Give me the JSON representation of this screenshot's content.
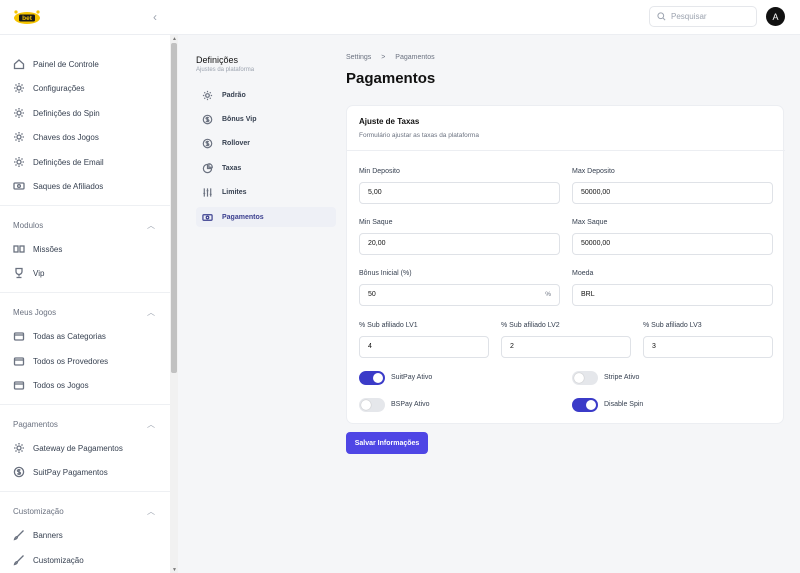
{
  "header": {
    "logo_text": "bet",
    "search_placeholder": "Pesquisar",
    "avatar_letter": "A"
  },
  "sidebar": {
    "top_items": [
      {
        "label": "Painel de Controle",
        "icon": "home-icon"
      },
      {
        "label": "Configurações",
        "icon": "gear-icon"
      },
      {
        "label": "Definições do Spin",
        "icon": "gear-icon"
      },
      {
        "label": "Chaves dos Jogos",
        "icon": "gear-icon"
      },
      {
        "label": "Definições de Email",
        "icon": "gear-icon"
      },
      {
        "label": "Saques de Afiliados",
        "icon": "money-icon"
      }
    ],
    "sections": [
      {
        "title": "Modulos",
        "items": [
          {
            "label": "Missões",
            "icon": "grid-icon"
          },
          {
            "label": "Vip",
            "icon": "trophy-icon"
          }
        ]
      },
      {
        "title": "Meus Jogos",
        "items": [
          {
            "label": "Todas as Categorias",
            "icon": "folder-icon"
          },
          {
            "label": "Todos os Provedores",
            "icon": "folder-icon"
          },
          {
            "label": "Todos os Jogos",
            "icon": "folder-icon"
          }
        ]
      },
      {
        "title": "Pagamentos",
        "items": [
          {
            "label": "Gateway de Pagamentos",
            "icon": "gear-icon"
          },
          {
            "label": "SuitPay Pagamentos",
            "icon": "dollar-icon"
          }
        ]
      },
      {
        "title": "Customização",
        "items": [
          {
            "label": "Banners",
            "icon": "brush-icon"
          },
          {
            "label": "Customização",
            "icon": "brush-icon"
          }
        ]
      }
    ]
  },
  "submenu": {
    "title": "Definições",
    "caption": "Ajustes da plataforma",
    "items": [
      {
        "label": "Padrão",
        "icon": "gear-icon"
      },
      {
        "label": "Bônus Vip",
        "icon": "dollar-icon"
      },
      {
        "label": "Rollover",
        "icon": "dollar-icon"
      },
      {
        "label": "Taxas",
        "icon": "pie-chart-icon"
      },
      {
        "label": "Limites",
        "icon": "sliders-icon"
      },
      {
        "label": "Pagamentos",
        "icon": "money-icon"
      }
    ],
    "active": "Pagamentos"
  },
  "breadcrumb": {
    "root": "Settings",
    "separator": ">",
    "current": "Pagamentos"
  },
  "page_title": "Pagamentos",
  "card": {
    "title": "Ajuste de Taxas",
    "description": "Formulário ajustar as taxas da plataforma",
    "fields": {
      "min_deposito": {
        "label": "Min Deposito",
        "value": "5,00"
      },
      "max_deposito": {
        "label": "Max Deposito",
        "value": "50000,00"
      },
      "min_saque": {
        "label": "Min Saque",
        "value": "20,00"
      },
      "max_saque": {
        "label": "Max Saque",
        "value": "50000,00"
      },
      "bonus_inicial": {
        "label": "Bônus Inicial (%)",
        "value": "50",
        "suffix": "%"
      },
      "moeda": {
        "label": "Moeda",
        "value": "BRL"
      },
      "sub_lv1": {
        "label": "% Sub afiliado LV1",
        "value": "4"
      },
      "sub_lv2": {
        "label": "% Sub afiliado LV2",
        "value": "2"
      },
      "sub_lv3": {
        "label": "% Sub afiliado LV3",
        "value": "3"
      }
    },
    "toggles": {
      "suitpay": {
        "label": "SuitPay Ativo",
        "on": true
      },
      "stripe": {
        "label": "Stripe Ativo",
        "on": false
      },
      "bspay": {
        "label": "BSPay Ativo",
        "on": false
      },
      "disable_spin": {
        "label": "Disable Spin",
        "on": true
      }
    }
  },
  "save_label": "Salvar Informações",
  "colors": {
    "accent": "#4f46e5",
    "toggle_on": "#3b3bc8",
    "active_menu": "#3b3f8f"
  }
}
